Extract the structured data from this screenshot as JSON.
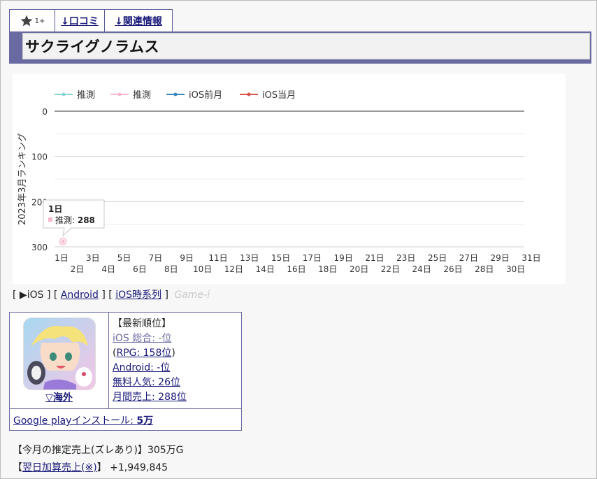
{
  "tabs": {
    "favorite_count": "1+",
    "reviews": "↓口コミ",
    "related": "↓関連情報"
  },
  "title": "サクライグノラムス",
  "chart_data": {
    "type": "line",
    "legend": [
      {
        "name": "推測",
        "color": "#8ad3d8"
      },
      {
        "name": "推測",
        "color": "#f5b8cc"
      },
      {
        "name": "iOS前月",
        "color": "#3a87b8"
      },
      {
        "name": "iOS当月",
        "color": "#d9534f"
      }
    ],
    "ylabel": "2023年3月ランキング",
    "ylim": [
      0,
      300
    ],
    "y_reversed": true,
    "y_ticks": [
      0,
      100,
      200,
      300
    ],
    "x_ticks_top": [
      "1日",
      "3日",
      "5日",
      "7日",
      "9日",
      "11日",
      "13日",
      "15日",
      "17日",
      "19日",
      "21日",
      "23日",
      "25日",
      "27日",
      "29日",
      "31日"
    ],
    "x_ticks_bottom": [
      "2日",
      "4日",
      "6日",
      "8日",
      "10日",
      "12日",
      "14日",
      "16日",
      "18日",
      "20日",
      "22日",
      "24日",
      "26日",
      "28日",
      "30日"
    ],
    "series": [
      {
        "name": "推測",
        "color": "#f5b8cc",
        "points": [
          {
            "day": 1,
            "value": 288
          }
        ]
      }
    ],
    "tooltip": {
      "title": "1日",
      "label": "推測",
      "value": "288"
    }
  },
  "platform": {
    "open": "[",
    "sep": "] [",
    "close": "]",
    "ios": "▶iOS",
    "android": "Android",
    "ios_series": "iOS時系列",
    "gamei": "Game-i"
  },
  "info": {
    "overseas": "▽海外",
    "latest_rank": "【最新順位】",
    "ios_total": "iOS 総合: -位",
    "rpg": "RPG: 158位",
    "android": "Android: -位",
    "free": "無料人気: 26位",
    "monthly_sales": "月間売上: 288位",
    "google_play_label": "Google playインストール: ",
    "google_play_value": "5万"
  },
  "sales": {
    "estimate_label": "【今月の推定売上(ズレあり)】",
    "estimate_value": "305万G",
    "next_day_open": "【",
    "next_day_link": "翌日加算売上(※)",
    "next_day_close": "】",
    "next_day_value": "+1,949,845"
  }
}
